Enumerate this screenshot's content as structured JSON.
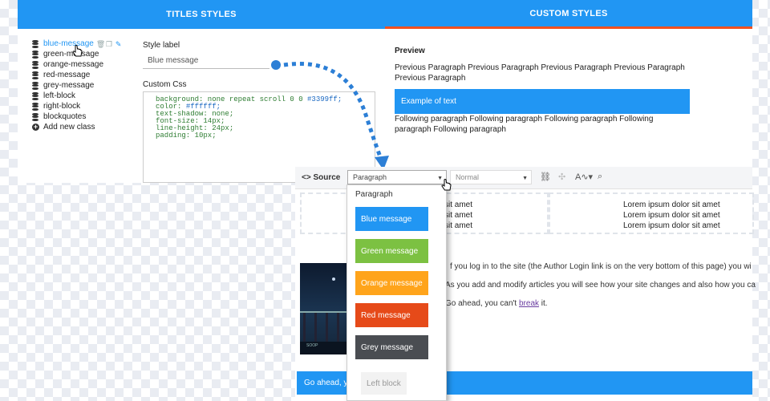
{
  "tabs": {
    "titles": "TITLES STYLES",
    "custom": "CUSTOM STYLES"
  },
  "class_list": [
    {
      "label": "blue-message",
      "active": true
    },
    {
      "label": "green-message"
    },
    {
      "label": "orange-message"
    },
    {
      "label": "red-message"
    },
    {
      "label": "grey-message"
    },
    {
      "label": "left-block"
    },
    {
      "label": "right-block"
    },
    {
      "label": "blockquotes"
    }
  ],
  "add_class": "Add new class",
  "form": {
    "style_label": "Style label",
    "style_value": "Blue message",
    "custom_css_label": "Custom Css",
    "css_lines": [
      [
        "background: none repeat scroll 0 0 ",
        "#3399ff;"
      ],
      [
        "color: ",
        "#ffffff;"
      ],
      [
        "text-shadow: none;",
        ""
      ],
      [
        "font-size: 14px;",
        ""
      ],
      [
        "line-height: 24px;",
        ""
      ],
      [
        "padding: 10px;",
        ""
      ]
    ]
  },
  "preview": {
    "title": "Preview",
    "previous": "Previous Paragraph Previous Paragraph Previous Paragraph Previous Paragraph Previous Paragraph",
    "example": "Example of text",
    "following": "Following paragraph Following paragraph Following paragraph Following paragraph Following paragraph"
  },
  "editor": {
    "source": "Source",
    "format_select": "Paragraph",
    "size_select": "Normal",
    "lorem_left": [
      "sit amet",
      "sit amet",
      "sit amet"
    ],
    "lorem_right": [
      "Lorem ipsum dolor sit amet",
      "Lorem ipsum dolor sit amet",
      "Lorem ipsum dolor sit amet"
    ],
    "line1": "f you log in to the site (the Author Login link is on the very bottom of this page) you wi",
    "line2": "As you add and modify articles you will see how your site changes and also how you ca",
    "line3_pre": "Go ahead, you can't ",
    "line3_link": "break",
    "line3_post": " it.",
    "image_caption": "SOOP",
    "bottom_bar": "Go ahead, y"
  },
  "dropdown": {
    "header": "Paragraph",
    "items": [
      {
        "label": "Blue message",
        "color": "#2196f3"
      },
      {
        "label": "Green message",
        "color": "#7cc142"
      },
      {
        "label": "Orange message",
        "color": "#ffa41b"
      },
      {
        "label": "Red message",
        "color": "#e64a19"
      },
      {
        "label": "Grey message",
        "color": "#4a4d52"
      },
      {
        "label": "Left block",
        "color": "#f2f2f2"
      }
    ]
  },
  "colors": {
    "accent": "#2196f3",
    "tab_underline": "#f4511e"
  }
}
